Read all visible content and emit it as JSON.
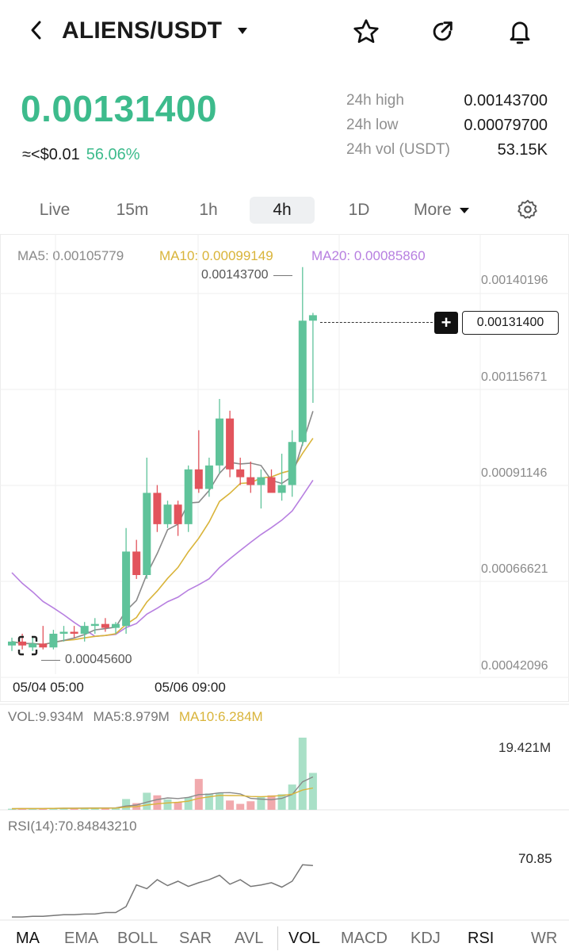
{
  "header": {
    "pair": "ALIENS/USDT"
  },
  "price": {
    "last": "0.00131400",
    "usd_approx": "≈<$0.01",
    "change_pct": "56.06%"
  },
  "stats": [
    {
      "label": "24h high",
      "value": "0.00143700"
    },
    {
      "label": "24h low",
      "value": "0.00079700"
    },
    {
      "label": "24h vol (USDT)",
      "value": "53.15K"
    }
  ],
  "timeframes": [
    "Live",
    "15m",
    "1h",
    "4h",
    "1D",
    "More"
  ],
  "active_timeframe": "4h",
  "ma_legend": {
    "ma5": "MA5: 0.00105779",
    "ma10": "MA10: 0.00099149",
    "ma20": "MA20: 0.00085860"
  },
  "price_axis": [
    "0.00140196",
    "0.00115671",
    "0.00091146",
    "0.00066621",
    "0.00042096"
  ],
  "markers": {
    "high": "0.00143700",
    "low": "0.00045600",
    "current": "0.00131400"
  },
  "time_axis": [
    "05/04 05:00",
    "05/06 09:00"
  ],
  "volume": {
    "vol": "VOL:9.934M",
    "ma5": "MA5:8.979M",
    "ma10": "MA10:6.284M",
    "axis_max": "19.421M"
  },
  "rsi": {
    "label": "RSI(14):70.84843210",
    "current": "70.85"
  },
  "indicators": [
    "MA",
    "EMA",
    "BOLL",
    "SAR",
    "AVL",
    "VOL",
    "MACD",
    "KDJ",
    "RSI",
    "WR"
  ],
  "colors": {
    "up": "#5fc39a",
    "down": "#e2545c",
    "ma5": "#8a8a8a",
    "ma10": "#d9b43a",
    "ma20": "#b77fe0",
    "price": "#3dbb8c"
  },
  "chart_data": [
    {
      "type": "candlestick",
      "title": "",
      "ylim": [
        0.00042096,
        0.00140196
      ],
      "candles": [
        {
          "o": 0.00047,
          "h": 0.00049,
          "l": 0.000456,
          "c": 0.00048
        },
        {
          "o": 0.00048,
          "h": 0.0005,
          "l": 0.00046,
          "c": 0.00047
        },
        {
          "o": 0.000465,
          "h": 0.00049,
          "l": 0.000456,
          "c": 0.000475
        },
        {
          "o": 0.000475,
          "h": 0.00052,
          "l": 0.00046,
          "c": 0.000465
        },
        {
          "o": 0.000465,
          "h": 0.00051,
          "l": 0.00046,
          "c": 0.0005
        },
        {
          "o": 0.0005,
          "h": 0.00052,
          "l": 0.00048,
          "c": 0.000505
        },
        {
          "o": 0.000505,
          "h": 0.00052,
          "l": 0.00049,
          "c": 0.0005
        },
        {
          "o": 0.0005,
          "h": 0.00053,
          "l": 0.00048,
          "c": 0.00052
        },
        {
          "o": 0.00052,
          "h": 0.00054,
          "l": 0.0005,
          "c": 0.000525
        },
        {
          "o": 0.000525,
          "h": 0.00054,
          "l": 0.000505,
          "c": 0.000515
        },
        {
          "o": 0.000515,
          "h": 0.00053,
          "l": 0.0005,
          "c": 0.000525
        },
        {
          "o": 0.00052,
          "h": 0.00077,
          "l": 0.0005,
          "c": 0.00071
        },
        {
          "o": 0.00071,
          "h": 0.00074,
          "l": 0.00064,
          "c": 0.00065
        },
        {
          "o": 0.00065,
          "h": 0.00095,
          "l": 0.00064,
          "c": 0.00086
        },
        {
          "o": 0.00086,
          "h": 0.00088,
          "l": 0.00076,
          "c": 0.00078
        },
        {
          "o": 0.00078,
          "h": 0.00084,
          "l": 0.00077,
          "c": 0.00083
        },
        {
          "o": 0.00083,
          "h": 0.00084,
          "l": 0.00075,
          "c": 0.00078
        },
        {
          "o": 0.00078,
          "h": 0.00093,
          "l": 0.00076,
          "c": 0.00092
        },
        {
          "o": 0.00092,
          "h": 0.00102,
          "l": 0.00086,
          "c": 0.00087
        },
        {
          "o": 0.00087,
          "h": 0.00095,
          "l": 0.00085,
          "c": 0.00093
        },
        {
          "o": 0.00093,
          "h": 0.0011,
          "l": 0.00091,
          "c": 0.00105
        },
        {
          "o": 0.00105,
          "h": 0.00107,
          "l": 0.0009,
          "c": 0.00092
        },
        {
          "o": 0.00092,
          "h": 0.00095,
          "l": 0.00088,
          "c": 0.0009
        },
        {
          "o": 0.0009,
          "h": 0.00094,
          "l": 0.00086,
          "c": 0.00088
        },
        {
          "o": 0.00088,
          "h": 0.00092,
          "l": 0.00082,
          "c": 0.0009
        },
        {
          "o": 0.0009,
          "h": 0.00092,
          "l": 0.00087,
          "c": 0.00086
        },
        {
          "o": 0.00086,
          "h": 0.00096,
          "l": 0.00084,
          "c": 0.00088
        },
        {
          "o": 0.00088,
          "h": 0.00102,
          "l": 0.00085,
          "c": 0.00099
        },
        {
          "o": 0.00099,
          "h": 0.001437,
          "l": 0.00098,
          "c": 0.0013
        },
        {
          "o": 0.0013,
          "h": 0.00132,
          "l": 0.00109,
          "c": 0.001314
        }
      ]
    },
    {
      "type": "bar",
      "title": "",
      "ylim": [
        0,
        19.421
      ],
      "values": [
        0.3,
        0.4,
        0.3,
        0.4,
        0.5,
        0.5,
        0.4,
        0.5,
        0.6,
        0.5,
        0.6,
        2.9,
        1.8,
        4.6,
        3.9,
        2.8,
        2.1,
        3.4,
        8.3,
        4.4,
        4.6,
        2.5,
        1.6,
        2.3,
        3.4,
        3.9,
        4.2,
        6.8,
        19.421,
        9.934
      ]
    },
    {
      "type": "line",
      "title": "",
      "ylim": [
        0,
        100
      ],
      "values": [
        2,
        2,
        3,
        3,
        4,
        5,
        5,
        6,
        6,
        8,
        8,
        16,
        45,
        40,
        52,
        44,
        50,
        43,
        48,
        52,
        58,
        46,
        52,
        43,
        45,
        48,
        42,
        50,
        72,
        71
      ]
    }
  ]
}
